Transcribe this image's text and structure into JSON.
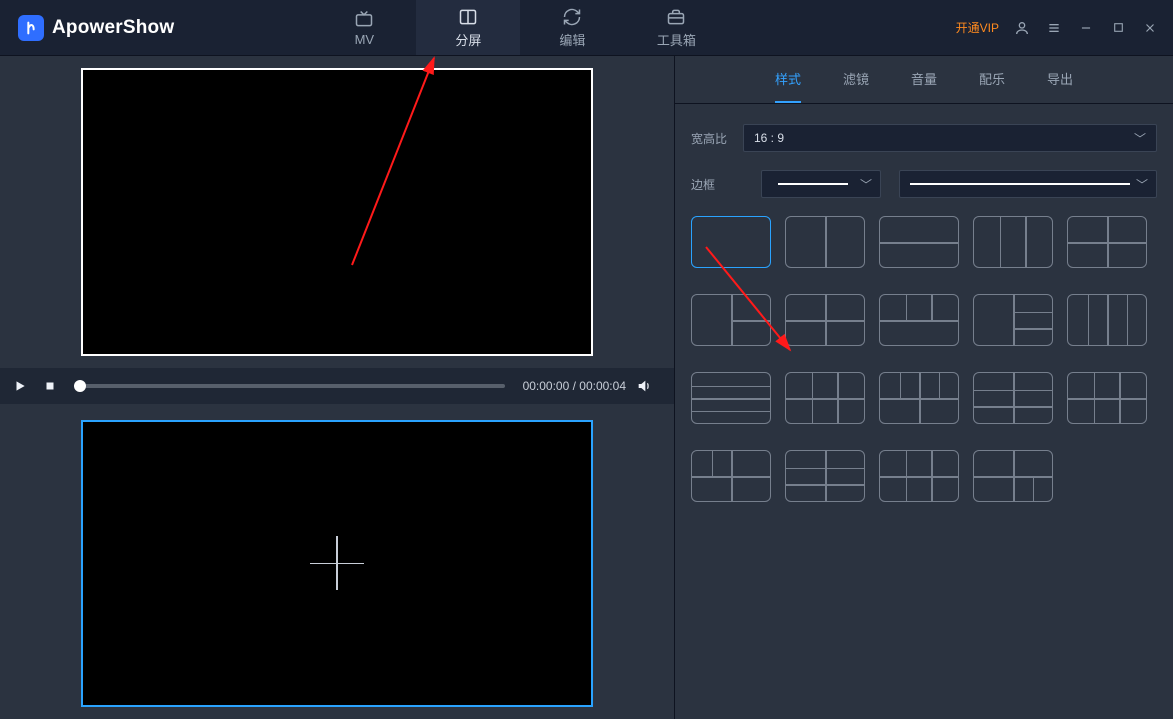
{
  "app": {
    "title": "ApowerShow"
  },
  "header": {
    "nav": [
      {
        "id": "mv",
        "label": "MV"
      },
      {
        "id": "split",
        "label": "分屏"
      },
      {
        "id": "edit",
        "label": "编辑"
      },
      {
        "id": "toolbox",
        "label": "工具箱"
      }
    ],
    "active_nav": "split",
    "vip_label": "开通VIP"
  },
  "player": {
    "current_time": "00:00:00",
    "total_time": "00:00:04",
    "time_display": "00:00:00 / 00:00:04"
  },
  "right_panel": {
    "tabs": [
      {
        "id": "style",
        "label": "样式"
      },
      {
        "id": "filter",
        "label": "滤镜"
      },
      {
        "id": "volume",
        "label": "音量"
      },
      {
        "id": "music",
        "label": "配乐"
      },
      {
        "id": "export",
        "label": "导出"
      }
    ],
    "active_tab": "style",
    "aspect_label": "宽高比",
    "aspect_value": "16 : 9",
    "border_label": "边框",
    "layout_selected_index": 0,
    "layouts": [
      {
        "v": [],
        "h": []
      },
      {
        "v": [
          50
        ],
        "h": []
      },
      {
        "v": [],
        "h": [
          50
        ]
      },
      {
        "v": [
          33,
          66
        ],
        "h": []
      },
      {
        "v": [
          50
        ],
        "h": [
          50
        ]
      },
      {
        "v": [
          50
        ],
        "h": [],
        "extra": [
          {
            "type": "h",
            "from": 50,
            "to": 100,
            "at": 50
          }
        ]
      },
      {
        "v": [
          50
        ],
        "h": [
          50
        ]
      },
      {
        "v": [
          33,
          66
        ],
        "h": [
          50
        ],
        "limit": "top"
      },
      {
        "v": [
          50
        ],
        "h": [
          33,
          66
        ],
        "limit": "right"
      },
      {
        "v": [
          25,
          50,
          75
        ],
        "h": []
      },
      {
        "v": [],
        "h": [
          25,
          50,
          75
        ]
      },
      {
        "v": [
          33,
          66
        ],
        "h": [
          50
        ]
      },
      {
        "v": [
          50
        ],
        "h": [
          50
        ],
        "extra": [
          {
            "type": "v",
            "from": 0,
            "to": 50,
            "at": 25
          },
          {
            "type": "v",
            "from": 0,
            "to": 50,
            "at": 75
          }
        ]
      },
      {
        "v": [
          50
        ],
        "h": [
          33,
          66
        ]
      },
      {
        "v": [
          33,
          66
        ],
        "h": [
          50
        ],
        "extra": [
          {
            "type": "h",
            "from": 0,
            "to": 33,
            "at": 50
          }
        ]
      },
      {
        "v": [
          50
        ],
        "h": [
          50
        ],
        "extra": [
          {
            "type": "v",
            "from": 0,
            "to": 50,
            "at": 25
          }
        ]
      },
      {
        "v": [
          50
        ],
        "h": [
          33,
          66
        ]
      },
      {
        "v": [
          33,
          66
        ],
        "h": [
          50
        ]
      },
      {
        "v": [
          50
        ],
        "h": [
          50
        ],
        "extra": [
          {
            "type": "v",
            "from": 50,
            "to": 100,
            "at": 75
          }
        ]
      },
      {
        "placeholder": true
      }
    ]
  }
}
